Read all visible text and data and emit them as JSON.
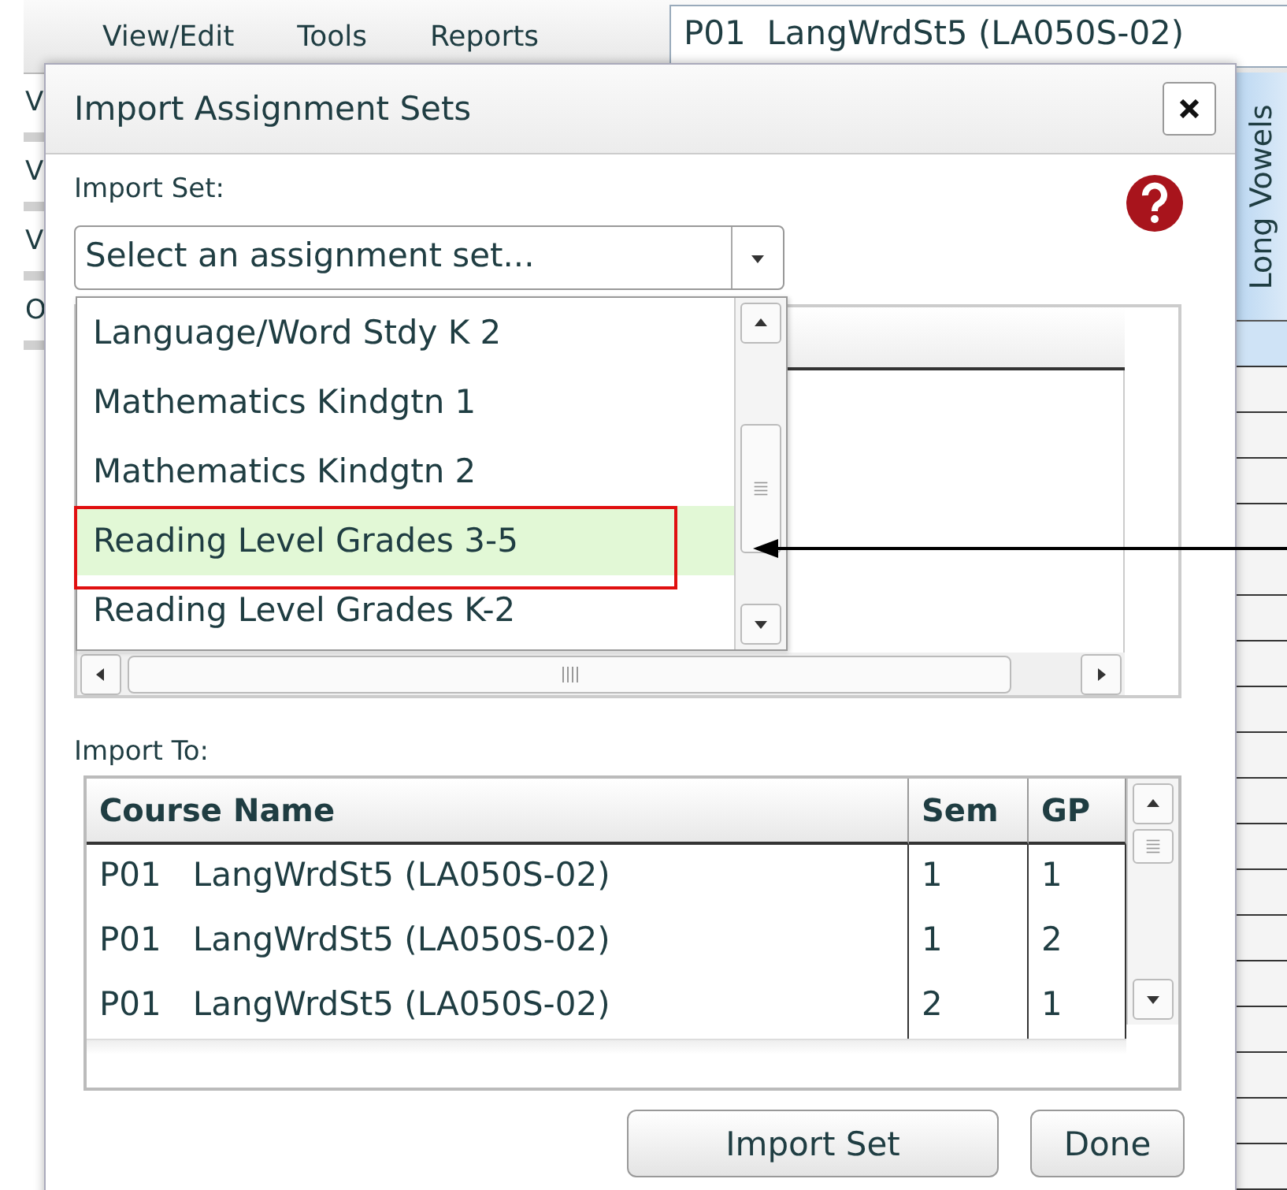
{
  "menu": [
    {
      "label": "View/Edit"
    },
    {
      "label": "Tools"
    },
    {
      "label": "Reports"
    }
  ],
  "course_field": {
    "value": "P01  LangWrdSt5 (LA050S-02)"
  },
  "side_items": [
    "V",
    "V",
    "V",
    "O"
  ],
  "column_header": "Long Vowels",
  "dialog": {
    "title": "Import Assignment Sets",
    "import_set_label": "Import Set:",
    "dropdown": {
      "placeholder": "Select an assignment set...",
      "expanded": true
    },
    "options": [
      {
        "label": "Language/Word Stdy K 2",
        "selected": false
      },
      {
        "label": "Mathematics Kindgtn 1",
        "selected": false
      },
      {
        "label": "Mathematics Kindgtn 2",
        "selected": false
      },
      {
        "label": "Reading Level Grades 3-5",
        "selected": true
      },
      {
        "label": "Reading Level Grades K-2",
        "selected": false
      }
    ],
    "import_to_label": "Import To:",
    "table": {
      "columns": [
        "Course Name",
        "Sem",
        "GP"
      ],
      "rows": [
        [
          "P01   LangWrdSt5 (LA050S-02)",
          "1",
          "1"
        ],
        [
          "P01   LangWrdSt5 (LA050S-02)",
          "1",
          "2"
        ],
        [
          "P01   LangWrdSt5 (LA050S-02)",
          "2",
          "1"
        ]
      ]
    },
    "buttons": [
      "Import Set",
      "Done"
    ]
  }
}
